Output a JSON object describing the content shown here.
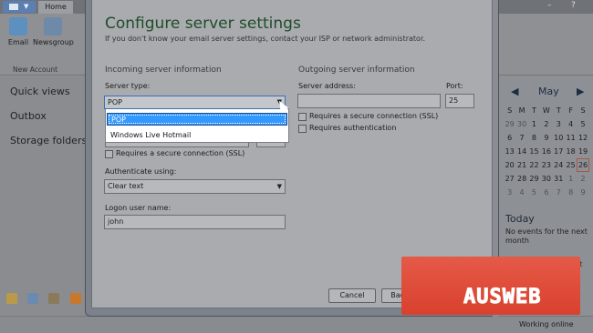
{
  "app": {
    "home_tab": "Home",
    "ribbon": {
      "items": [
        "Email",
        "Newsgroup"
      ],
      "group_label": "New Account"
    },
    "sidebar": {
      "items": [
        "Quick views",
        "Outbox",
        "Storage folders"
      ]
    },
    "calendar": {
      "month": "May",
      "weekdays": [
        "S",
        "M",
        "T",
        "W",
        "T",
        "F",
        "S"
      ],
      "rows": [
        [
          "29",
          "30",
          "1",
          "2",
          "3",
          "4",
          "5"
        ],
        [
          "6",
          "7",
          "8",
          "9",
          "10",
          "11",
          "12"
        ],
        [
          "13",
          "14",
          "15",
          "16",
          "17",
          "18",
          "19"
        ],
        [
          "20",
          "21",
          "22",
          "23",
          "24",
          "25",
          "26"
        ],
        [
          "27",
          "28",
          "29",
          "30",
          "31",
          "1",
          "2"
        ],
        [
          "3",
          "4",
          "5",
          "6",
          "7",
          "8",
          "9"
        ]
      ],
      "today_title": "Today",
      "today_text": "No events for the next month",
      "quick_event": "Type a quick event for today (26/05)"
    },
    "status": "Working online"
  },
  "dialog": {
    "title": "Configure server settings",
    "subtitle": "If you don't know your email server settings, contact your ISP or network administrator.",
    "incoming": {
      "heading": "Incoming server information",
      "server_type_label": "Server type:",
      "server_type_value": "POP",
      "dropdown_options": [
        "POP",
        "Windows Live Hotmail"
      ],
      "ssl_label": "Requires a secure connection (SSL)",
      "auth_label": "Authenticate using:",
      "auth_value": "Clear text",
      "logon_label": "Logon user name:",
      "logon_value": "john"
    },
    "outgoing": {
      "heading": "Outgoing server information",
      "server_address_label": "Server address:",
      "port_label": "Port:",
      "port_value": "25",
      "ssl_label": "Requires a secure connection (SSL)",
      "auth_label": "Requires authentication"
    },
    "buttons": {
      "cancel": "Cancel",
      "back": "Back"
    }
  },
  "watermark": {
    "text": "AUSWEB"
  }
}
